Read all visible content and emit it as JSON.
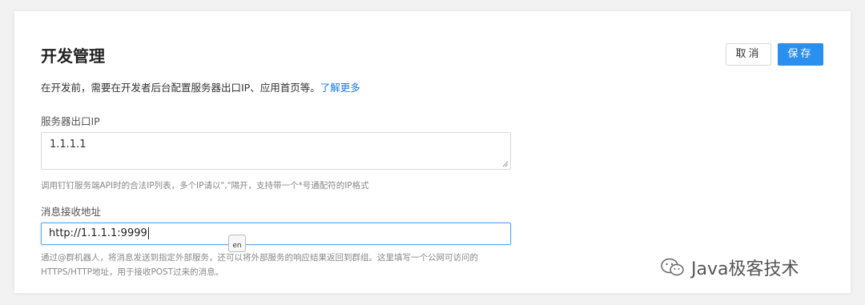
{
  "page": {
    "title": "开发管理",
    "buttons": {
      "cancel": "取消",
      "save": "保存"
    },
    "description": "在开发前，需要在开发者后台配置服务器出口IP、应用首页等。",
    "learn_more": "了解更多"
  },
  "server_ip": {
    "label": "服务器出口IP",
    "value": "1.1.1.1",
    "hint": "调用钉钉服务端API时的合法IP列表，多个IP请以\",\"隔开，支持带一个*号通配符的IP格式"
  },
  "message_url": {
    "label": "消息接收地址",
    "value": "http://1.1.1.1:9999",
    "hint_line1": "通过@群机器人，将消息发送到指定外部服务，还可以将外部服务的响应结果返回到群组。这里填写一个公网可访问的",
    "hint_line2": "HTTPS/HTTP地址，用于接收POST过来的消息。"
  },
  "ime_indicator": "en",
  "watermark": "Java极客技术",
  "colors": {
    "accent": "#2b8ff0",
    "link": "#1a7ae6"
  }
}
